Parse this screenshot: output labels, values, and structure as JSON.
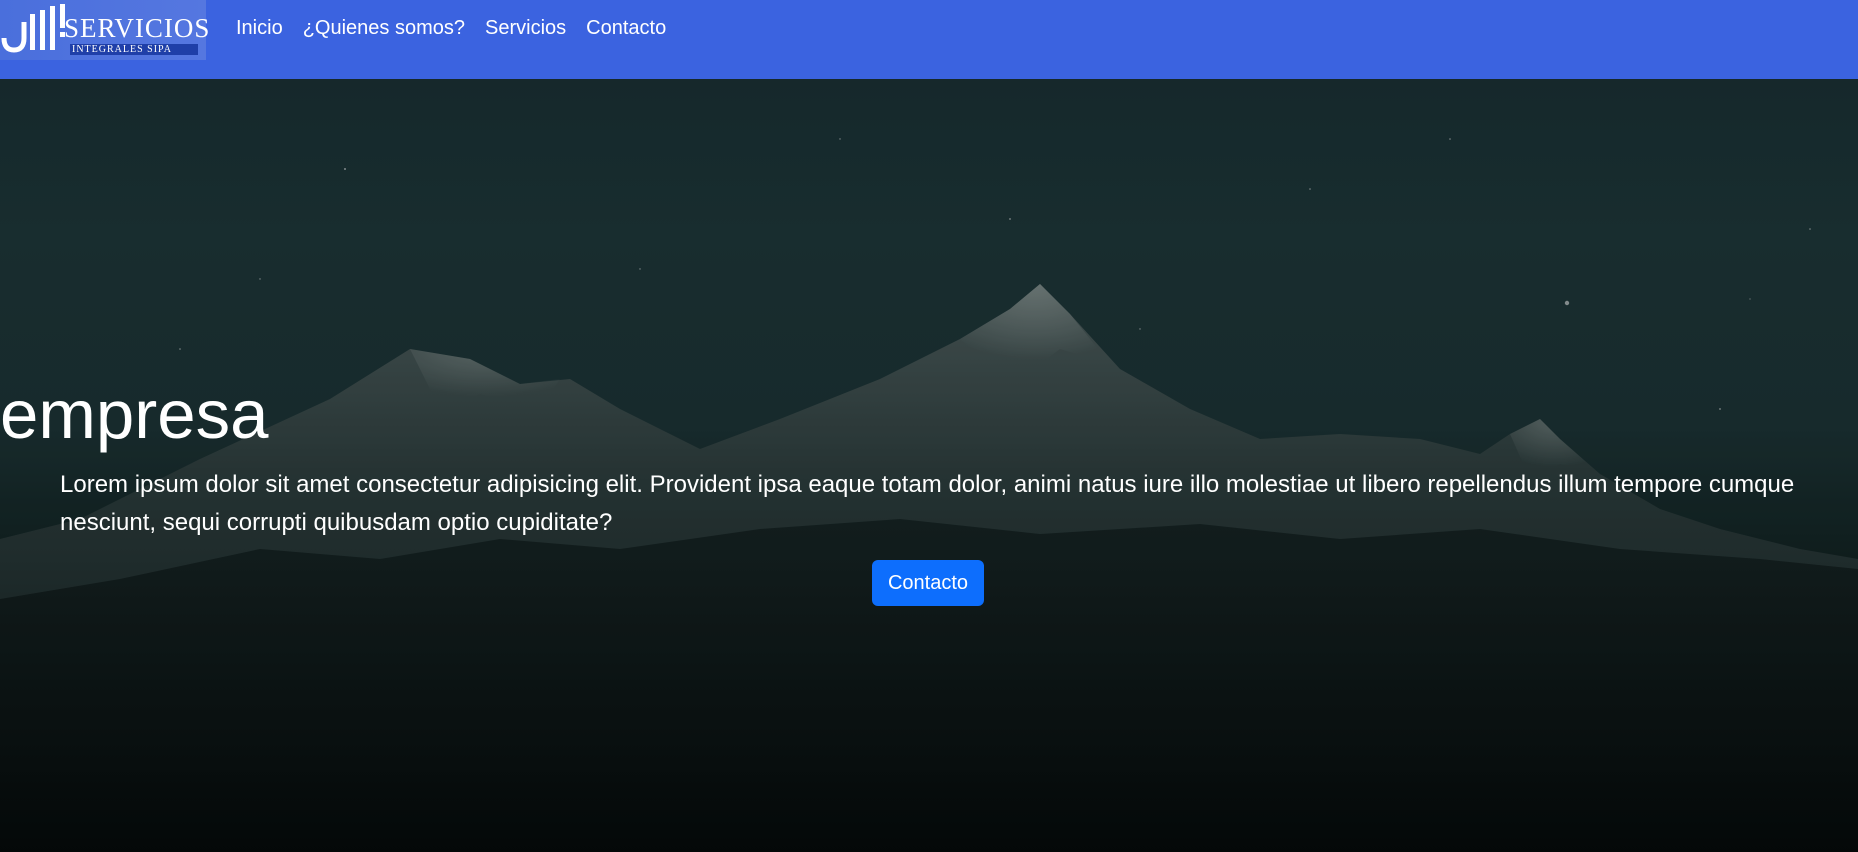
{
  "navbar": {
    "logo": {
      "word": "SERVICIOS",
      "sub": "INTEGRALES SIPA"
    },
    "links": [
      {
        "label": "Inicio"
      },
      {
        "label": "¿Quienes somos?"
      },
      {
        "label": "Servicios"
      },
      {
        "label": "Contacto"
      }
    ]
  },
  "hero": {
    "title": "empresa",
    "text": "Lorem ipsum dolor sit amet consectetur adipisicing elit. Provident ipsa eaque totam dolor, animi natus iure illo molestiae ut libero repellendus illum tempore cumque nesciunt, sequi corrupti quibusdam optio cupiditate?",
    "button_label": "Contacto"
  },
  "colors": {
    "navbar_bg": "#3b63e0",
    "button_bg": "#0d6efd",
    "text": "#ffffff"
  }
}
